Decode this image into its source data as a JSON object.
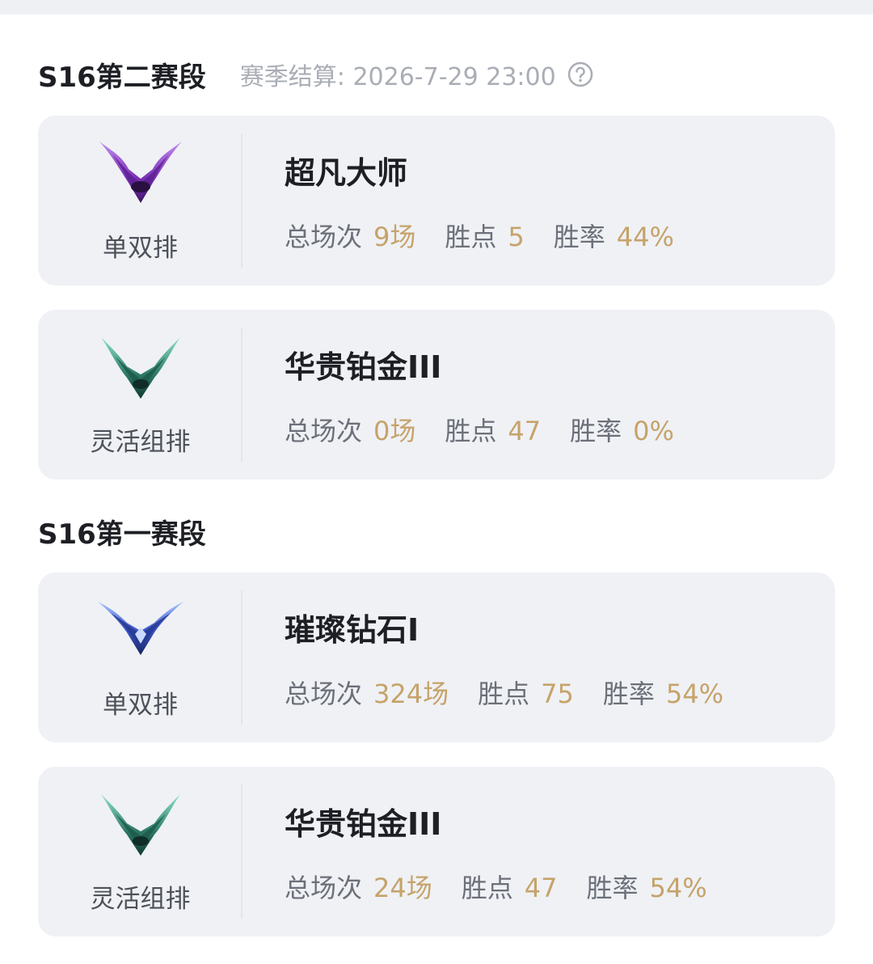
{
  "seasons": [
    {
      "title": "S16第二赛段",
      "settle_text": "赛季结算: 2026-7-29 23:00",
      "cards": [
        {
          "queue": "单双排",
          "rank": "超凡大师",
          "emblem": "master-emblem",
          "color": "#8a3fc2",
          "games_label": "总场次",
          "games": "9场",
          "lp_label": "胜点",
          "lp": "5",
          "wr_label": "胜率",
          "wr": "44%"
        },
        {
          "queue": "灵活组排",
          "rank": "华贵铂金III",
          "emblem": "platinum-emblem",
          "color": "#2e7d6e",
          "games_label": "总场次",
          "games": "0场",
          "lp_label": "胜点",
          "lp": "47",
          "wr_label": "胜率",
          "wr": "0%"
        }
      ]
    },
    {
      "title": "S16第一赛段",
      "settle_text": "",
      "cards": [
        {
          "queue": "单双排",
          "rank": "璀璨钻石I",
          "emblem": "diamond-emblem",
          "color": "#3a55c8",
          "games_label": "总场次",
          "games": "324场",
          "lp_label": "胜点",
          "lp": "75",
          "wr_label": "胜率",
          "wr": "54%"
        },
        {
          "queue": "灵活组排",
          "rank": "华贵铂金III",
          "emblem": "platinum-emblem",
          "color": "#2e7d6e",
          "games_label": "总场次",
          "games": "24场",
          "lp_label": "胜点",
          "lp": "47",
          "wr_label": "胜率",
          "wr": "54%"
        }
      ]
    }
  ],
  "colors": {
    "accent": "#c6a36a",
    "card_bg": "#eff1f5",
    "muted": "#a9adb5"
  }
}
